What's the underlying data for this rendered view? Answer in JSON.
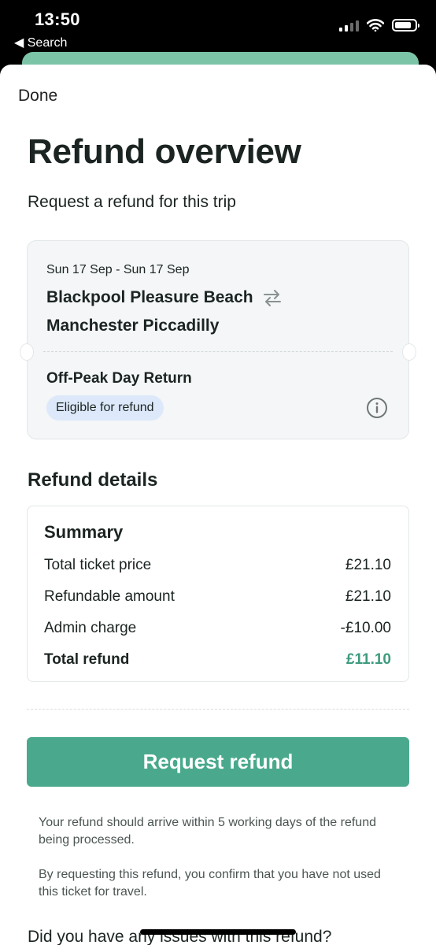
{
  "status_bar": {
    "time": "13:50",
    "back_label": "◀ Search"
  },
  "sheet": {
    "done_label": "Done",
    "title": "Refund overview",
    "subtitle": "Request a refund for this trip"
  },
  "ticket": {
    "dates": "Sun 17 Sep - Sun 17 Sep",
    "origin": "Blackpool Pleasure Beach",
    "destination": "Manchester Piccadilly",
    "ticket_type": "Off-Peak Day Return",
    "badge": "Eligible for refund",
    "return_icon": "swap-arrows-icon",
    "info_icon": "info-icon"
  },
  "refund_details": {
    "heading": "Refund details",
    "summary_title": "Summary",
    "rows": [
      {
        "label": "Total ticket price",
        "value": "£21.10"
      },
      {
        "label": "Refundable amount",
        "value": "£21.10"
      },
      {
        "label": "Admin charge",
        "value": "-£10.00"
      }
    ],
    "total": {
      "label": "Total refund",
      "value": "£11.10"
    }
  },
  "actions": {
    "request_refund_label": "Request refund"
  },
  "notes": {
    "arrival": "Your refund should arrive within 5 working days of the refund being processed.",
    "confirmation": "By requesting this refund, you confirm that you have not used this ticket for travel."
  },
  "footer": {
    "question": "Did you have any issues with this refund?"
  },
  "colors": {
    "accent": "#4aa98c",
    "total_refund": "#3e9b7e",
    "badge_bg": "#dde9fa"
  }
}
